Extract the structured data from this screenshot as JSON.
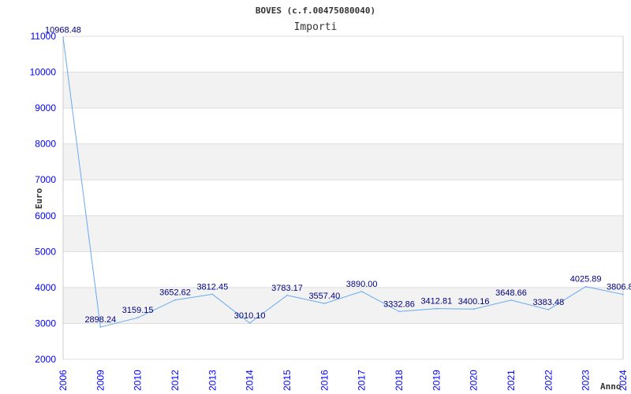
{
  "chart_data": {
    "type": "line",
    "title": "BOVES (c.f.00475080040)",
    "subtitle": "Importi",
    "xlabel": "Anno",
    "ylabel": "Euro",
    "ylim": [
      2000,
      11000
    ],
    "yticks": [
      2000,
      3000,
      4000,
      5000,
      6000,
      7000,
      8000,
      9000,
      10000,
      11000
    ],
    "grid": true,
    "categories": [
      "2006",
      "2009",
      "2010",
      "2012",
      "2013",
      "2014",
      "2015",
      "2016",
      "2017",
      "2018",
      "2019",
      "2020",
      "2021",
      "2022",
      "2023",
      "2024"
    ],
    "values": [
      10968.48,
      2898.24,
      3159.15,
      3652.62,
      3812.45,
      3010.1,
      3783.17,
      3557.4,
      3890.0,
      3332.86,
      3412.81,
      3400.16,
      3648.66,
      3383.48,
      4025.89,
      3806.8
    ],
    "data_labels": [
      "10968.48",
      "2898.24",
      "3159.15",
      "3652.62",
      "3812.45",
      "3010.10",
      "3783.17",
      "3557.40",
      "3890.00",
      "3332.86",
      "3412.81",
      "3400.16",
      "3648.66",
      "3383.48",
      "4025.89",
      "3806.8"
    ],
    "colors": {
      "line": "#66aaee",
      "band": "#f2f2f2",
      "ticks": "#0000ff",
      "labels": "#000080"
    }
  }
}
